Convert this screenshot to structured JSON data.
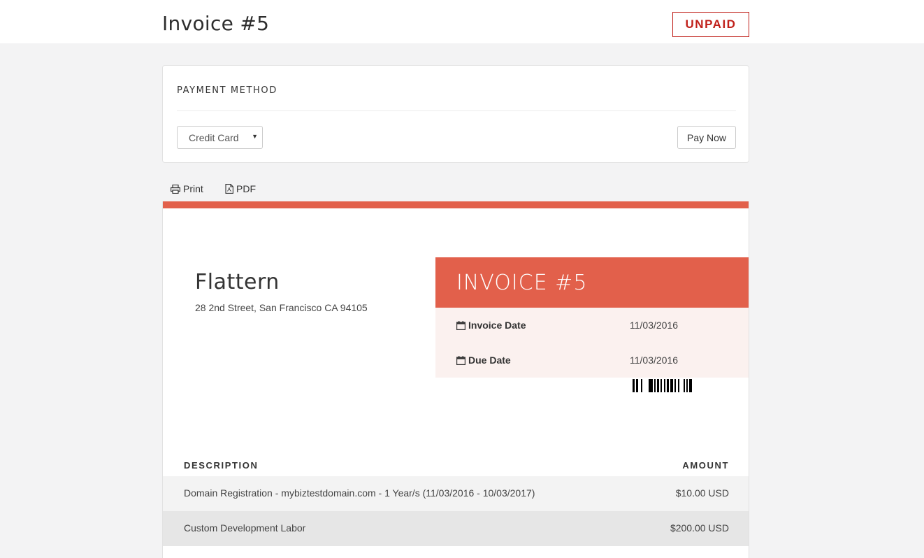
{
  "header": {
    "title": "Invoice #5",
    "status": "UNPAID",
    "status_color": "#c0201a"
  },
  "payment": {
    "heading": "PAYMENT METHOD",
    "method_selected": "Credit Card",
    "pay_button": "Pay Now"
  },
  "actions": {
    "print_label": "Print",
    "print_icon": "printer-icon",
    "pdf_label": "PDF",
    "pdf_icon": "file-pdf-icon"
  },
  "invoice": {
    "accent_color": "#e2604b",
    "company_name": "Flattern",
    "company_address": "28 2nd Street, San Francisco CA 94105",
    "banner_title": "INVOICE #5",
    "dates": [
      {
        "label": "Invoice Date",
        "value": "11/03/2016",
        "icon": "calendar-icon"
      },
      {
        "label": "Due Date",
        "value": "11/03/2016",
        "icon": "calendar-icon"
      }
    ]
  },
  "table": {
    "headers": {
      "description": "DESCRIPTION",
      "amount": "AMOUNT"
    },
    "rows": [
      {
        "description": "Domain Registration - mybiztestdomain.com - 1 Year/s (11/03/2016 - 10/03/2017)",
        "amount": "$10.00 USD"
      },
      {
        "description": "Custom Development Labor",
        "amount": "$200.00 USD"
      }
    ]
  }
}
